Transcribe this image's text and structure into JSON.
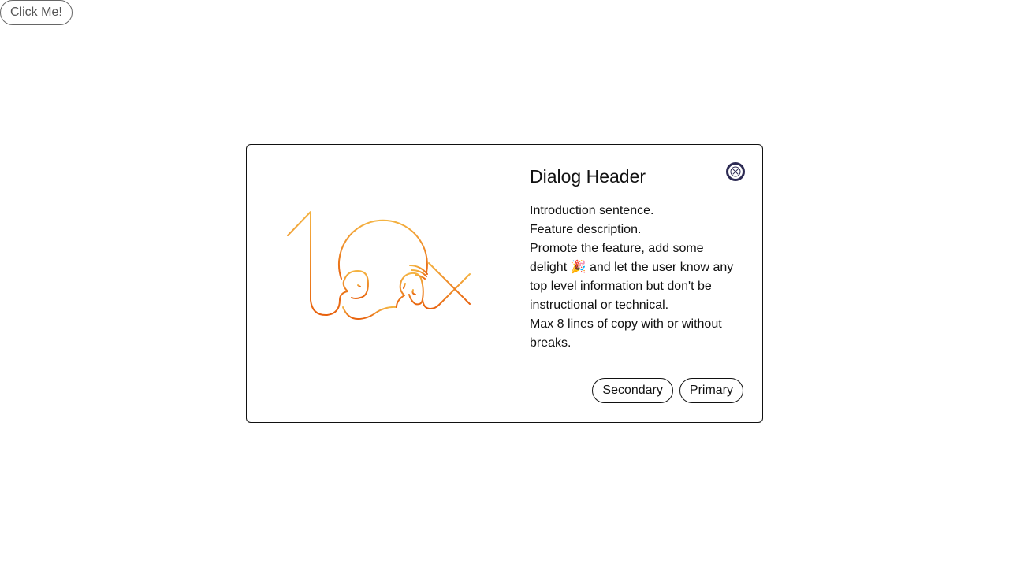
{
  "page": {
    "trigger_label": "Click Me!"
  },
  "dialog": {
    "title": "Dialog Header",
    "body": [
      "Introduction sentence.",
      "Feature description.",
      "Promote the feature, add some delight 🎉 and let the user know any top level information but don't be instructional or technical.",
      "Max 8 lines of copy with or without breaks."
    ],
    "close_icon": "close-circle-icon",
    "illustration_icon": "ten-x-illustration-icon",
    "buttons": {
      "secondary": "Secondary",
      "primary": "Primary"
    }
  },
  "colors": {
    "illustration_light": "#F4B342",
    "illustration_dark": "#E8610D",
    "close_border": "#2D2B54"
  }
}
